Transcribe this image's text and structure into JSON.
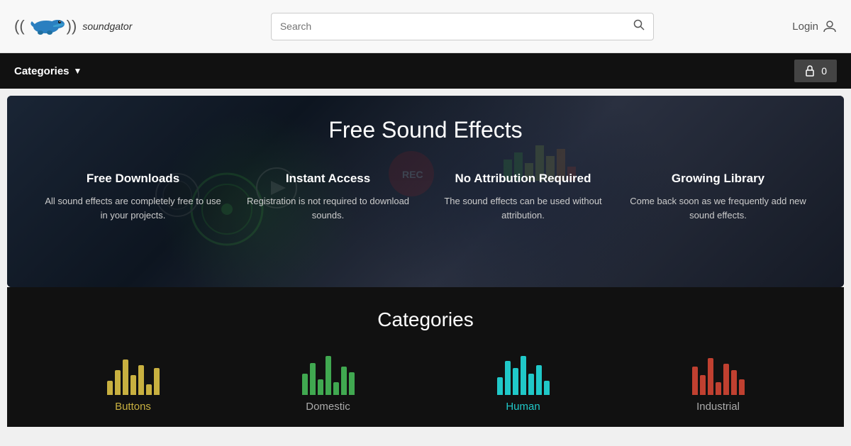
{
  "header": {
    "logo_text": "soundgator",
    "search_placeholder": "Search",
    "login_label": "Login",
    "cart_count": "0"
  },
  "navbar": {
    "categories_label": "Categories",
    "categories_arrow": "▼"
  },
  "hero": {
    "title": "Free Sound Effects",
    "features": [
      {
        "title": "Free Downloads",
        "desc": "All sound effects are completely free to use in your projects."
      },
      {
        "title": "Instant Access",
        "desc": "Registration is not required to download sounds."
      },
      {
        "title": "No Attribution Required",
        "desc": "The sound effects can be used without attribution."
      },
      {
        "title": "Growing Library",
        "desc": "Come back soon as we frequently add new sound effects."
      }
    ]
  },
  "categories_section": {
    "title": "Categories",
    "items": [
      {
        "label": "Buttons",
        "class": "buttons"
      },
      {
        "label": "Domestic",
        "class": "domestic"
      },
      {
        "label": "Human",
        "class": "human"
      },
      {
        "label": "Industrial",
        "class": "industrial"
      }
    ]
  },
  "icons": {
    "search": "🔍",
    "user": "👤",
    "lock": "🔒",
    "chevron_down": "▾"
  }
}
